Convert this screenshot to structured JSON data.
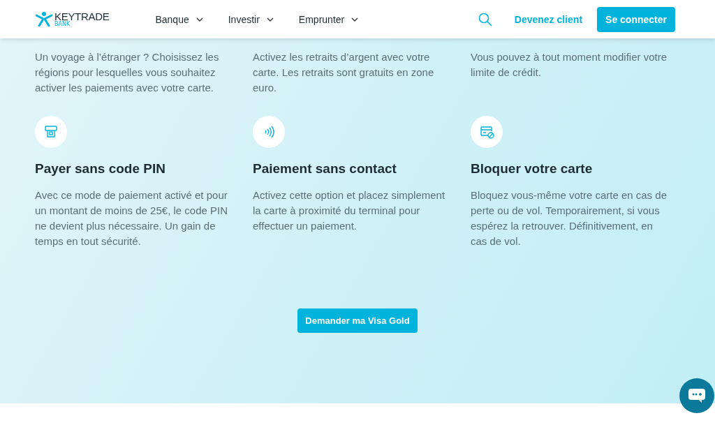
{
  "header": {
    "logo": {
      "name": "KEYTRADE",
      "sub": "BANK"
    },
    "nav": [
      {
        "label": "Banque",
        "expanded": false
      },
      {
        "label": "Investir",
        "expanded": false
      },
      {
        "label": "Emprunter",
        "expanded": false
      }
    ],
    "link": "Devenez client",
    "button": "Se connecter"
  },
  "top_features": [
    {
      "text": "Un voyage à l’étranger ? Choisissez les régions pour lesquelles vous souhaitez activer les paiements avec votre carte."
    },
    {
      "text": "Activez les retraits d’argent avec votre carte. Les retraits sont gratuits en zone euro."
    },
    {
      "text": "Vous pouvez à tout moment modifier votre limite de crédit."
    }
  ],
  "features": [
    {
      "kind": "atm",
      "title": "Payer sans code PIN",
      "text": "Avec ce mode de paiement activé et pour un montant de moins de 25€, le code PIN ne devient plus nécessaire. Un gain de temps en tout sécurité."
    },
    {
      "kind": "contactless",
      "title": "Paiement sans contact",
      "text": "Activez cette option et placez simplement la carte à proximité du terminal pour effectuer un paiement."
    },
    {
      "kind": "block",
      "title": "Bloquer votre carte",
      "text": "Bloquez vous-même votre carte en cas de perte ou de vol. Temporairement, si vous espérez la retrouver. Définitivement, en cas de vol."
    }
  ],
  "cta": "Demander ma Visa Gold"
}
